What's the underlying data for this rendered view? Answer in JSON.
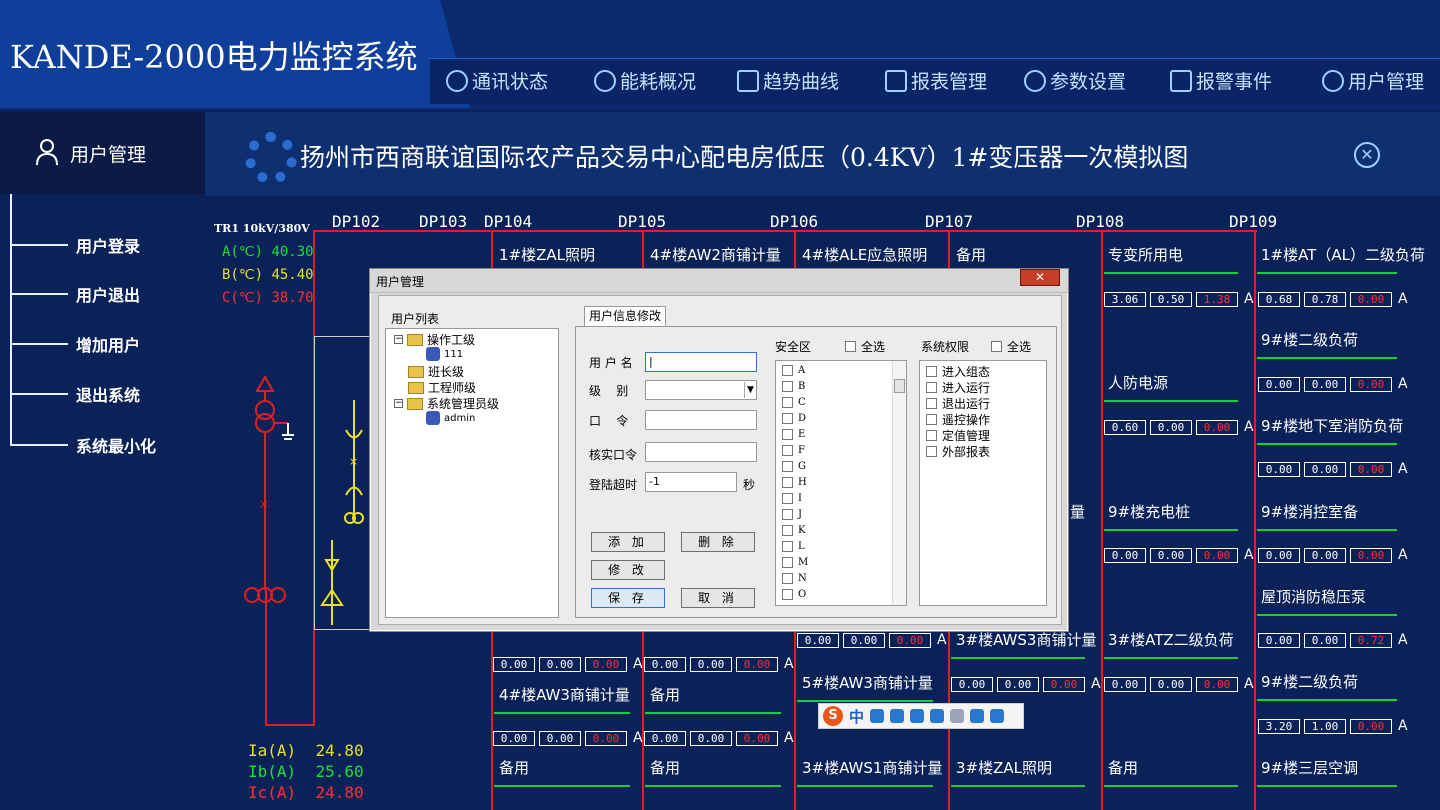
{
  "app": {
    "title": "KANDE-2000电力监控系统"
  },
  "nav": [
    {
      "label": "通讯状态",
      "icon": "signal-icon"
    },
    {
      "label": "能耗概况",
      "icon": "pie-icon"
    },
    {
      "label": "趋势曲线",
      "icon": "trend-icon"
    },
    {
      "label": "报表管理",
      "icon": "report-icon"
    },
    {
      "label": "参数设置",
      "icon": "gear-icon"
    },
    {
      "label": "报警事件",
      "icon": "alarm-icon"
    },
    {
      "label": "用户管理",
      "icon": "user-icon"
    }
  ],
  "sidebar": {
    "header": "用户管理",
    "items": [
      "用户登录",
      "用户退出",
      "增加用户",
      "退出系统",
      "系统最小化"
    ]
  },
  "content": {
    "title": "扬州市西商联谊国际农产品交易中心配电房低压（0.4KV）1#变压器一次模拟图"
  },
  "diagram": {
    "transformer": "TR1 10kV/380V",
    "temps": [
      "A(℃) 40.30",
      "B(℃) 45.40",
      "C(℃) 38.70"
    ],
    "currents": [
      {
        "label": "Ia(A)",
        "value": "24.80"
      },
      {
        "label": "Ib(A)",
        "value": "25.60"
      },
      {
        "label": "Ic(A)",
        "value": "24.80"
      }
    ],
    "panels": [
      "DP102",
      "DP103",
      "DP104",
      "DP105",
      "DP106",
      "DP107",
      "DP108",
      "DP109"
    ],
    "unit": "A",
    "feeders": [
      {
        "name": "1#楼ZAL照明"
      },
      {
        "name": "4#楼AW2商铺计量"
      },
      {
        "name": "4#楼ALE应急照明"
      },
      {
        "name": "备用"
      },
      {
        "name": "专变所用电",
        "values": [
          "3.06",
          "0.50",
          "1.38"
        ]
      },
      {
        "name": "1#楼AT（AL）二级负荷",
        "values": [
          "0.68",
          "0.78",
          "0.00"
        ]
      },
      {
        "name": "9#楼二级负荷",
        "values": [
          "0.00",
          "0.00",
          "0.00"
        ]
      },
      {
        "name": "人防电源",
        "values": [
          "0.60",
          "0.00",
          "0.00"
        ]
      },
      {
        "name": "9#楼地下室消防负荷",
        "values": [
          "0.00",
          "0.00",
          "0.00"
        ]
      },
      {
        "name": "量"
      },
      {
        "name": "9#楼充电桩",
        "values": [
          "0.00",
          "0.00",
          "0.00"
        ]
      },
      {
        "name": "9#楼消控室备",
        "values": [
          "0.00",
          "0.00",
          "0.00"
        ]
      },
      {
        "name": "屋顶消防稳压泵",
        "values": [
          "0.00",
          "0.00",
          "0.72"
        ]
      },
      {
        "name": "3#楼AWS3商铺计量",
        "values": [
          "0.00",
          "0.00",
          "0.00"
        ]
      },
      {
        "name": "3#楼ATZ二级负荷",
        "values": [
          "0.00",
          "0.00",
          "0.00"
        ]
      },
      {
        "name": "9#楼二级负荷",
        "values": [
          "3.20",
          "1.00",
          "0.00"
        ]
      },
      {
        "name": "4#楼AW3商铺计量",
        "values": [
          "0.00",
          "0.00",
          "0.00"
        ]
      },
      {
        "name": "备用",
        "values": [
          "0.00",
          "0.00",
          "0.00"
        ]
      },
      {
        "name": "5#楼AW3商铺计量"
      },
      {
        "name": "备用"
      },
      {
        "name": "备用"
      },
      {
        "name": "3#楼AWS1商铺计量"
      },
      {
        "name": "3#楼ZAL照明"
      },
      {
        "name": "备用"
      },
      {
        "name": "9#楼三层空调"
      }
    ],
    "extra_values": {
      "row1": [
        "0.00",
        "0.00",
        "0.00"
      ],
      "row2": [
        "0.00",
        "0.00",
        "0.00"
      ],
      "row3": [
        "0.00",
        "0.00",
        "0.00"
      ]
    }
  },
  "dialog": {
    "title": "用户管理",
    "user_list_label": "用户列表",
    "tree": [
      {
        "label": "操作工级",
        "children": [
          "111"
        ]
      },
      {
        "label": "班长级",
        "children": []
      },
      {
        "label": "工程师级",
        "children": []
      },
      {
        "label": "系统管理员级",
        "children": [
          "admin"
        ]
      }
    ],
    "tab": "用户信息修改",
    "fields": {
      "username_label": "用 户 名",
      "level_label": "级    别",
      "password_label": "口    令",
      "confirm_label": "核实口令",
      "timeout_label": "登陆超时",
      "timeout_value": "-1",
      "timeout_unit": "秒"
    },
    "buttons": {
      "add": "添 加",
      "delete": "删 除",
      "modify": "修 改",
      "save": "保 存",
      "cancel": "取 消"
    },
    "security_zone": {
      "label": "安全区",
      "select_all": "全选",
      "items": [
        "A",
        "B",
        "C",
        "D",
        "E",
        "F",
        "G",
        "H",
        "I",
        "J",
        "K",
        "L",
        "M",
        "N",
        "O"
      ]
    },
    "permissions": {
      "label": "系统权限",
      "select_all": "全选",
      "items": [
        "进入组态",
        "进入运行",
        "退出运行",
        "遥控操作",
        "定值管理",
        "外部报表"
      ]
    }
  },
  "ime": {
    "lang": "中"
  }
}
